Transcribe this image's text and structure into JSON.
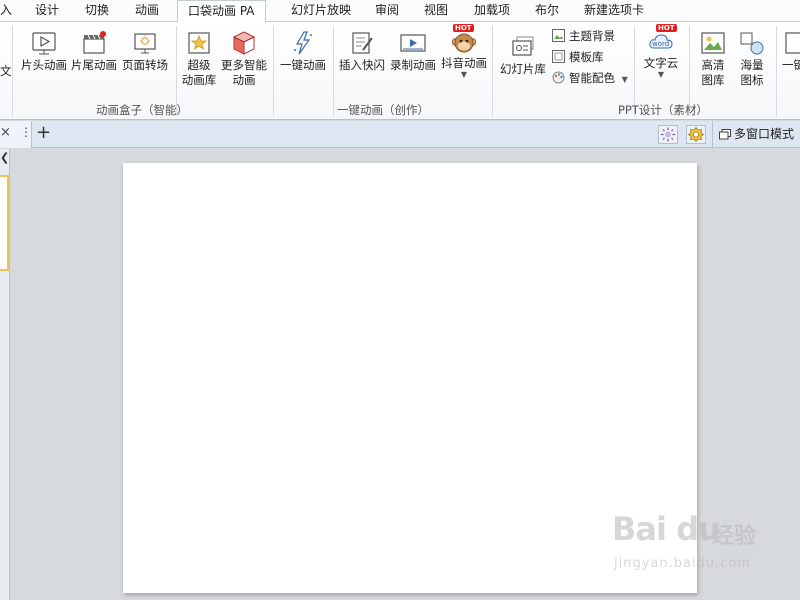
{
  "menu_tabs": [
    {
      "label": "入"
    },
    {
      "label": "设计"
    },
    {
      "label": "切换"
    },
    {
      "label": "动画"
    },
    {
      "label": "口袋动画 PA"
    },
    {
      "label": "幻灯片放映"
    },
    {
      "label": "审阅"
    },
    {
      "label": "视图"
    },
    {
      "label": "加载项"
    },
    {
      "label": "布尔"
    },
    {
      "label": "新建选项卡"
    }
  ],
  "ribbon": {
    "partial_left": "文",
    "animation_box": {
      "buttons": [
        "片头动画",
        "片尾动画",
        "页面转场"
      ],
      "super_lib": [
        "超级",
        "动画库"
      ],
      "more_smart": [
        "更多智能",
        "动画"
      ],
      "label": "动画盒子（智能）"
    },
    "one_key": {
      "buttons": [
        "一键动画",
        "插入快闪",
        "录制动画",
        "抖音动画"
      ],
      "hot": "HOT",
      "label": "一键动画（创作）"
    },
    "ppt_design": {
      "slide_lib": "幻灯片库",
      "small": [
        "主题背景",
        "模板库",
        "智能配色"
      ],
      "word_cloud": "文字云",
      "word_icon_text": "word",
      "hd_lib": [
        "高清",
        "图库"
      ],
      "mass_icon": [
        "海量",
        "图标"
      ],
      "partial_right": "一键",
      "label": "PPT设计（素材）"
    }
  },
  "tabstrip": {
    "close_glyph": "×",
    "dots_glyph": "⋮",
    "add_glyph": "+",
    "multi_window": "多窗口模式"
  },
  "watermark": {
    "logo": "Bai du",
    "brand": "经验",
    "url": "jingyan.baidu.com"
  },
  "colors": {
    "accent": "#f1c25a",
    "hot": "#e02020"
  }
}
